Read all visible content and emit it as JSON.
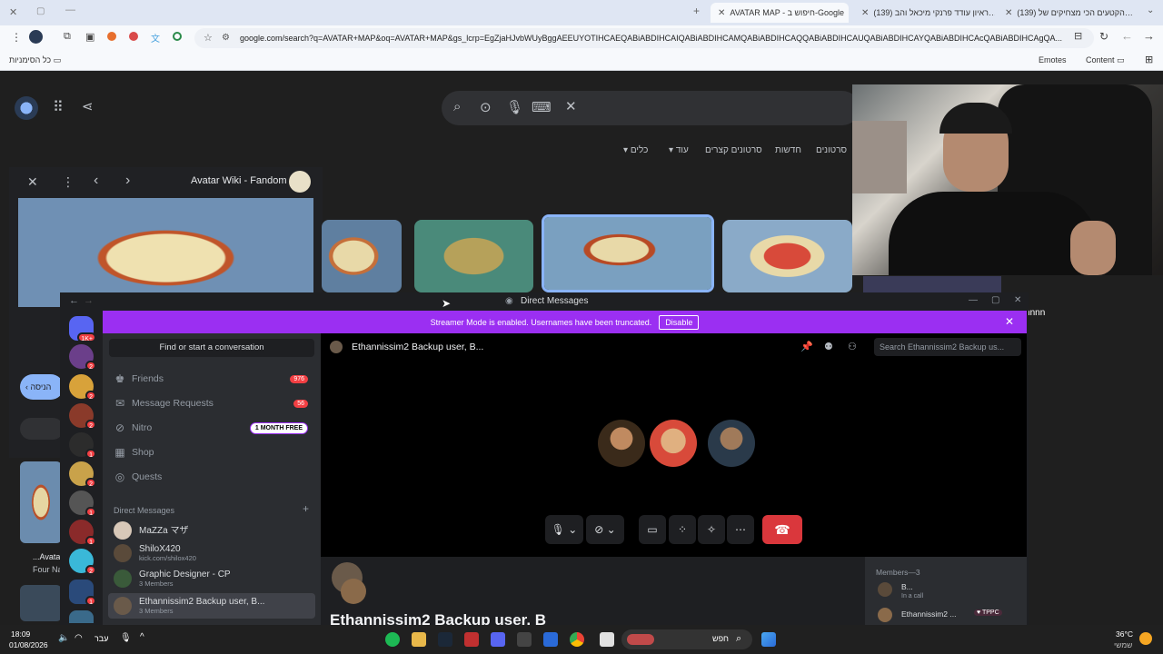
{
  "tabs": [
    {
      "label": "(139) הקטעים הכי מצחיקים של…",
      "kind": "youtube"
    },
    {
      "label": "(139) ראיון עודד פרנקי מיכאל והב…",
      "kind": "youtube"
    },
    {
      "label": "AVATAR MAP - חיפוש ב-Google",
      "kind": "google",
      "active": true
    }
  ],
  "toolbar": {
    "url": "google.com/search?q=AVATAR+MAP&oq=AVATAR+MAP&gs_lcrp=EgZjaHJvbWUyBggAEEUYOTIHCAEQABiABDIHCAIQABiABDIHCAMQABiABDIHCAQQABiABDIHCAUQABiABDIHCAYQABiABDIHCAcQABiABDIHCAgQA..."
  },
  "bookmarks": {
    "folder": "כל הסימניות",
    "emotes": "Emotes",
    "content": "Content"
  },
  "google": {
    "tabs": [
      "סרטונים",
      "חדשות",
      "סרטונים קצרים",
      "עוד",
      "כלים"
    ],
    "panel_source": "Avatar Wiki - Fandom",
    "left_label_1": "...Avata",
    "left_label_2": "Four Na",
    "back_pill": "הניסה"
  },
  "webcam": {
    "chat_line": "nnnnnnnnnnnnn"
  },
  "discord": {
    "window_title": "Direct Messages",
    "streamer_banner": "Streamer Mode is enabled. Usernames have been truncated.",
    "disable_label": "Disable",
    "find_placeholder": "Find or start a conversation",
    "nav": [
      {
        "label": "Friends",
        "badge": "976"
      },
      {
        "label": "Message Requests",
        "badge": "56"
      },
      {
        "label": "Nitro",
        "tag": "1 MONTH FREE"
      },
      {
        "label": "Shop"
      },
      {
        "label": "Quests"
      }
    ],
    "dm_header": "Direct Messages",
    "dms": [
      {
        "name": "MaZZa マザ",
        "sub": ""
      },
      {
        "name": "ShiloX420",
        "sub": "kick.com/shilox420"
      },
      {
        "name": "Graphic Designer - CP",
        "sub": "3 Members"
      },
      {
        "name": "Ethannissim2 Backup user, B...",
        "sub": "3 Members"
      }
    ],
    "server_badges": [
      "1K+",
      "2",
      "2",
      "2",
      "1",
      "2",
      "1",
      "1",
      "2",
      "1",
      "1"
    ],
    "chat_title": "Ethannissim2 Backup user, B...",
    "search_placeholder": "Search Ethannissim2 Backup us...",
    "chat_bottom_title": "Ethannissim2 Backup user, B",
    "members_header": "Members—3",
    "member_1": "B...",
    "member_1_status": "In a call",
    "member_2": "Ethannissim2 ...",
    "member_2_tag": "TPPC"
  },
  "taskbar": {
    "time": "18:09",
    "date": "01/08/2026",
    "lang": "עבר",
    "search": "חפש",
    "temp": "36°C",
    "weather": "שמשי"
  },
  "colors": {
    "streamer": "#9b2ff2",
    "hangup": "#da373c",
    "badge": "#f23f43"
  }
}
